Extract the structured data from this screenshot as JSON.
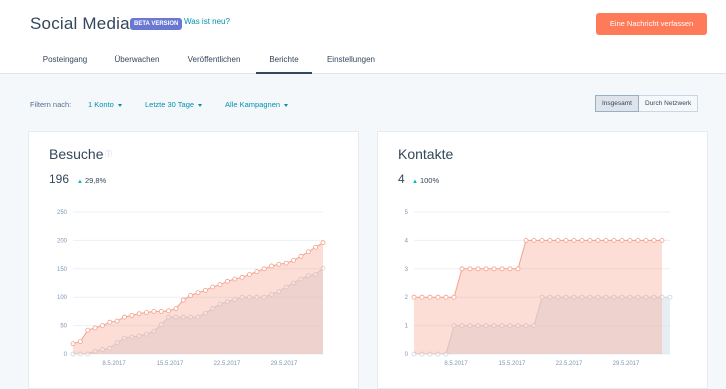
{
  "app": {
    "title": "Social Media",
    "beta_badge": "BETA VERSION",
    "whats_new": "Was ist neu?",
    "compose_button": "Eine Nachricht verfassen"
  },
  "tabs": [
    {
      "label": "Posteingang"
    },
    {
      "label": "Überwachen"
    },
    {
      "label": "Veröffentlichen"
    },
    {
      "label": "Berichte",
      "active": true
    },
    {
      "label": "Einstellungen"
    }
  ],
  "filters": {
    "label": "Filtern nach:",
    "account": "1 Konto",
    "range": "Letzte 30 Tage",
    "campaign": "Alle Kampagnen"
  },
  "view_toggle": {
    "total": "Insgesamt",
    "by_network": "Durch Netzwerk",
    "selected": "Insgesamt"
  },
  "icons": {
    "info": "info-circle-icon",
    "caret": "caret-down-icon",
    "trend": "arrow-up-icon"
  },
  "colors": {
    "accent": "#ff7a59",
    "link": "#0091ae",
    "beta": "#6a78d1",
    "trend_up": "#00bda5",
    "series_current": "#f5a08a",
    "series_previous": "#cbd6e2"
  },
  "cards": {
    "visits": {
      "title": "Besuche",
      "total": "196",
      "change": "29,8%"
    },
    "contacts": {
      "title": "Kontakte",
      "total": "4",
      "change": "100%"
    }
  },
  "chart_data": [
    {
      "type": "area",
      "title": "Besuche",
      "x_tick_labels": [
        "8.5.2017",
        "15.5.2017",
        "22.5.2017",
        "29.5.2017"
      ],
      "y_ticks": [
        0,
        50,
        100,
        150,
        200,
        250
      ],
      "ylim": [
        0,
        250
      ],
      "grid": true,
      "series": [
        {
          "values": [
            18,
            22,
            42,
            46,
            50,
            56,
            58,
            65,
            68,
            71,
            73,
            75,
            75,
            76,
            80,
            95,
            103,
            108,
            112,
            118,
            122,
            128,
            132,
            135,
            140,
            145,
            150,
            155,
            158,
            160,
            165,
            172,
            180,
            188,
            196
          ]
        },
        {
          "values": [
            0,
            0,
            0,
            5,
            8,
            10,
            20,
            28,
            30,
            32,
            35,
            40,
            52,
            65,
            65,
            65,
            65,
            65,
            72,
            80,
            88,
            92,
            96,
            100,
            100,
            100,
            100,
            105,
            110,
            118,
            125,
            132,
            138,
            140,
            151
          ]
        }
      ]
    },
    {
      "type": "area",
      "title": "Kontakte",
      "x_tick_labels": [
        "8.5.2017",
        "15.5.2017",
        "22.5.2017",
        "29.5.2017"
      ],
      "y_ticks": [
        0,
        1,
        2,
        3,
        4,
        5
      ],
      "ylim": [
        0,
        5
      ],
      "grid": true,
      "series": [
        {
          "values": [
            2,
            2,
            2,
            2,
            2,
            2,
            3,
            3,
            3,
            3,
            3,
            3,
            3,
            3,
            4,
            4,
            4,
            4,
            4,
            4,
            4,
            4,
            4,
            4,
            4,
            4,
            4,
            4,
            4,
            4,
            4,
            4
          ]
        },
        {
          "values": [
            0,
            0,
            0,
            0,
            0,
            1,
            1,
            1,
            1,
            1,
            1,
            1,
            1,
            1,
            1,
            1,
            2,
            2,
            2,
            2,
            2,
            2,
            2,
            2,
            2,
            2,
            2,
            2,
            2,
            2,
            2,
            2,
            2
          ]
        }
      ]
    }
  ]
}
